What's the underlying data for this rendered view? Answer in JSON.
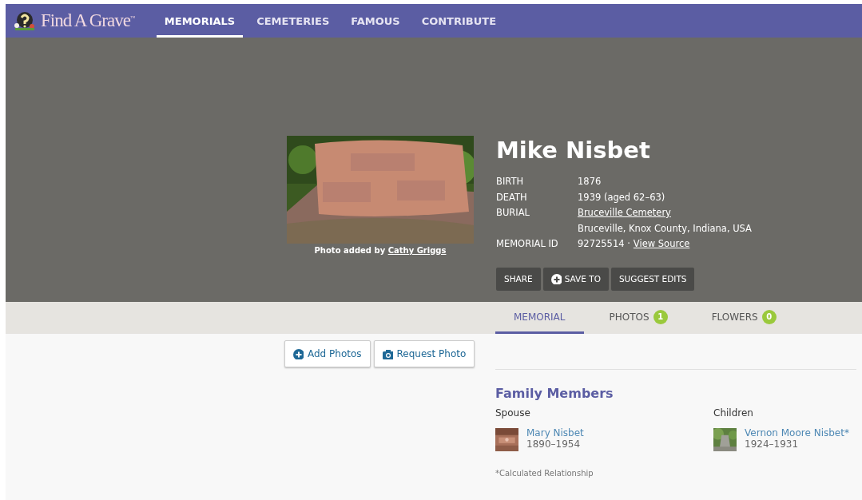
{
  "nav": {
    "logo": "Find A Grave$^{™}$",
    "items": [
      {
        "label": "MEMORIALS",
        "selected": true
      },
      {
        "label": "CEMETERIES",
        "selected": false
      },
      {
        "label": "FAMOUS",
        "selected": false
      },
      {
        "label": "CONTRIBUTE",
        "selected": false
      }
    ]
  },
  "memorial": {
    "photo": {
      "kind": "picture",
      "caption": "Photo added by ",
      "credit": "Cathy Griggs"
    },
    "name": "Mike Nisbet",
    "facts": [
      {
        "label": "BIRTH",
        "value": "1876"
      },
      {
        "label": "DEATH",
        "value": "1939 (aged 62–63)"
      },
      {
        "label": "BURIAL",
        "link": "Bruceville Cemetery",
        "detail": "Bruceville, Knox County, Indiana, USA"
      },
      {
        "label": "MEMORIAL ID",
        "value": "92725514 ·",
        "link": "View Source"
      }
    ],
    "actions": [
      {
        "label": "SHARE",
        "kind": "plain"
      },
      {
        "label": "SAVE TO",
        "kind": "add"
      },
      {
        "label": "SUGGEST EDITS",
        "kind": "plain"
      }
    ]
  },
  "tabs": [
    {
      "label": "MEMORIAL",
      "selected": true
    },
    {
      "label": "PHOTOS",
      "count": "1",
      "selected": false
    },
    {
      "label": "FLOWERS",
      "count": "0",
      "selected": false
    }
  ],
  "photo_buttons": [
    {
      "label": "Add Photos",
      "kind": "add"
    },
    {
      "label": "Request Photo",
      "kind": "camera"
    }
  ],
  "family": {
    "title": "Family Members",
    "groups": [
      {
        "heading": "Spouse",
        "members": [
          {
            "name": "Mary Nisbet",
            "years": "1890–1954"
          }
        ]
      },
      {
        "heading": "Children",
        "members": [
          {
            "name": "Vernon Moore Nisbet*",
            "years": "1924–1931"
          }
        ]
      }
    ],
    "note": "*Calculated Relationship"
  }
}
